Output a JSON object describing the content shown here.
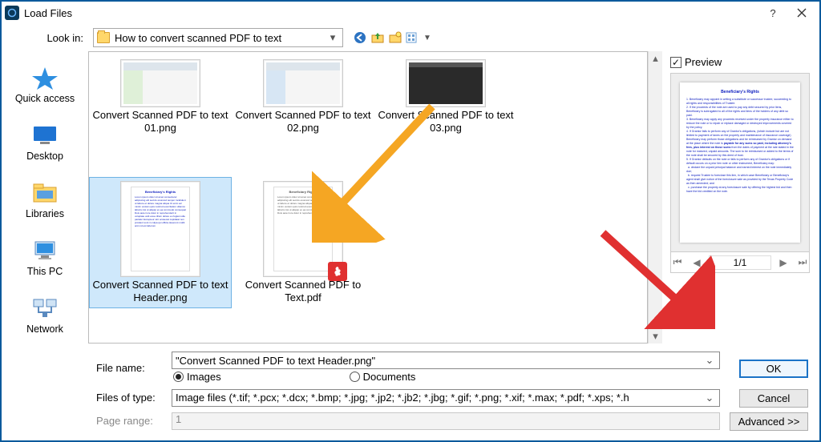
{
  "window": {
    "title": "Load Files"
  },
  "toolbar": {
    "lookin_label": "Look in:",
    "lookin_value": "How to convert scanned PDF to text"
  },
  "sidebar": {
    "items": [
      {
        "label": "Quick access"
      },
      {
        "label": "Desktop"
      },
      {
        "label": "Libraries"
      },
      {
        "label": "This PC"
      },
      {
        "label": "Network"
      }
    ]
  },
  "files": {
    "row1": [
      {
        "name": "Convert Scanned PDF to text 01.png"
      },
      {
        "name": "Convert Scanned PDF to text 02.png"
      },
      {
        "name": "Convert Scanned PDF to text 03.png"
      }
    ],
    "row2": [
      {
        "name": "Convert Scanned PDF to text Header.png",
        "selected": true
      },
      {
        "name": "Convert Scanned PDF to Text.pdf"
      }
    ]
  },
  "preview": {
    "label": "Preview",
    "page_indicator": "1/1"
  },
  "bottom": {
    "file_name_label": "File name:",
    "file_name_value": "\"Convert Scanned PDF to text Header.png\"",
    "radio_images": "Images",
    "radio_documents": "Documents",
    "files_of_type_label": "Files of type:",
    "files_of_type_value": "Image files (*.tif; *.pcx; *.dcx; *.bmp; *.jpg; *.jp2; *.jb2; *.jbg; *.gif; *.png; *.xif; *.max; *.pdf; *.xps; *.h",
    "page_range_label": "Page range:",
    "page_range_value": "1",
    "ok_label": "OK",
    "cancel_label": "Cancel",
    "advanced_label": "Advanced >>"
  }
}
